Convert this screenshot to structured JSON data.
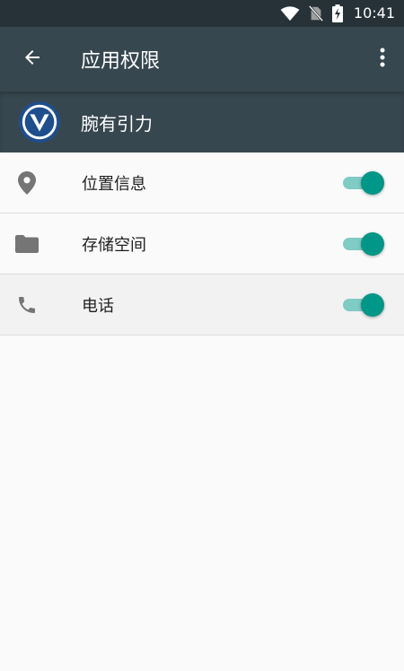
{
  "status_bar": {
    "time": "10:41",
    "icons": [
      "wifi-icon",
      "no-sim-icon",
      "battery-charging-icon"
    ]
  },
  "toolbar": {
    "title": "应用权限",
    "back_icon": "arrow-back-icon",
    "more_icon": "more-vert-icon"
  },
  "app": {
    "name": "腕有引力",
    "icon": "app-logo-icon"
  },
  "permissions": [
    {
      "label": "位置信息",
      "icon": "location-pin-icon",
      "enabled": true
    },
    {
      "label": "存储空间",
      "icon": "folder-icon",
      "enabled": true
    },
    {
      "label": "电话",
      "icon": "phone-icon",
      "enabled": true
    }
  ],
  "colors": {
    "status_bar": "#263238",
    "toolbar": "#37474f",
    "toggle_thumb": "#009688",
    "toggle_track": "#80cbc4",
    "background": "#fafafa"
  }
}
